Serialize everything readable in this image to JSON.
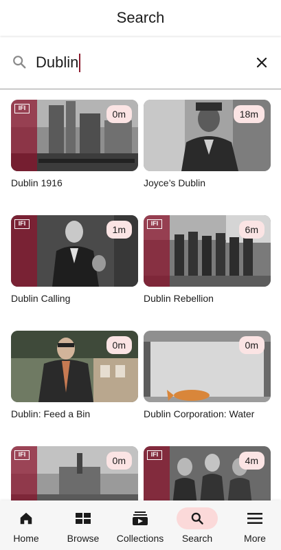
{
  "header": {
    "title": "Search"
  },
  "search": {
    "query": "Dublin",
    "search_icon": "search-icon",
    "clear_icon": "close-icon"
  },
  "results": [
    {
      "title": "Dublin 1916",
      "duration": "0m",
      "ifi_branding": true
    },
    {
      "title": "Joyce’s Dublin",
      "duration": "18m",
      "ifi_branding": false
    },
    {
      "title": "Dublin Calling",
      "duration": "1m",
      "ifi_branding": true
    },
    {
      "title": "Dublin Rebellion",
      "duration": "6m",
      "ifi_branding": true
    },
    {
      "title": "Dublin: Feed a Bin",
      "duration": "0m",
      "ifi_branding": false
    },
    {
      "title": "Dublin Corporation: Water",
      "duration": "0m",
      "ifi_branding": false
    },
    {
      "title": "",
      "duration": "0m",
      "ifi_branding": true
    },
    {
      "title": "",
      "duration": "4m",
      "ifi_branding": true
    }
  ],
  "ifi": {
    "logo_text": "IFI",
    "logo_subtext": "Irish Film Institute"
  },
  "bottom_nav": [
    {
      "label": "Home",
      "icon": "home-icon",
      "active": false
    },
    {
      "label": "Browse",
      "icon": "grid-icon",
      "active": false
    },
    {
      "label": "Collections",
      "icon": "collections-icon",
      "active": false
    },
    {
      "label": "Search",
      "icon": "search-icon",
      "active": true
    },
    {
      "label": "More",
      "icon": "menu-icon",
      "active": false
    }
  ],
  "colors": {
    "accent": "#8c142d",
    "badge_bg": "#fbe4e4",
    "active_nav_bg": "#fbd9d9"
  }
}
